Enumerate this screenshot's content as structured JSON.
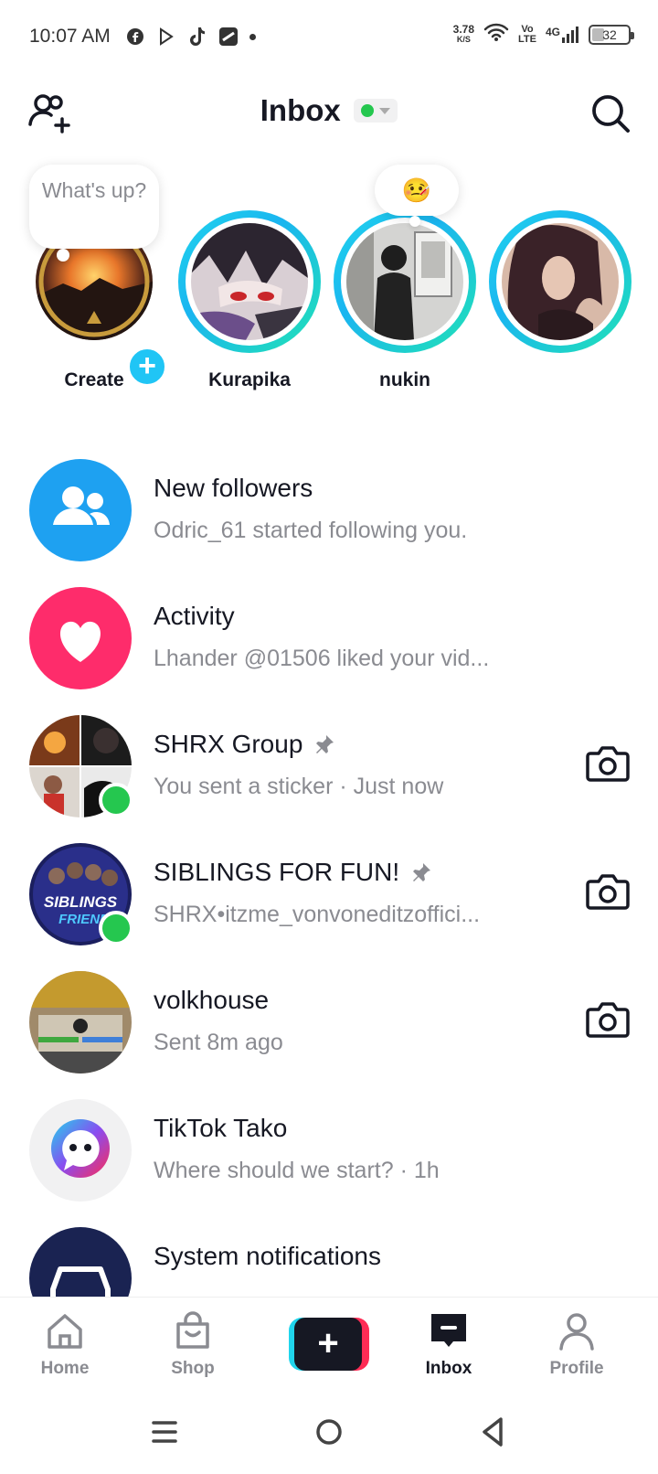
{
  "status_bar": {
    "time": "10:07 AM",
    "speed_value": "3.78",
    "speed_unit": "K/S",
    "volte_top": "Vo",
    "volte_bottom": "LTE",
    "network": "4G",
    "battery": "32"
  },
  "header": {
    "title": "Inbox",
    "status_color": "#25c74f"
  },
  "stories": {
    "bubble_text": "What's up?",
    "bubble_emoji": "🤒",
    "items": [
      {
        "name": "Create"
      },
      {
        "name": "Kurapika"
      },
      {
        "name": "nukin"
      },
      {
        "name": ""
      }
    ]
  },
  "list": [
    {
      "title": "New followers",
      "subtitle": "Odric_61 started following you."
    },
    {
      "title": "Activity",
      "subtitle": "Lhander @01506 liked your vid..."
    },
    {
      "title": "SHRX Group",
      "subtitle": "You sent a sticker · Just now"
    },
    {
      "title": "SIBLINGS FOR FUN!",
      "subtitle": "SHRX•itzme_vonvoneditzoffici..."
    },
    {
      "title": "volkhouse",
      "subtitle": "Sent 8m ago"
    },
    {
      "title": "TikTok Tako",
      "subtitle": "Where should we start?  · 1h"
    },
    {
      "title": "System notifications",
      "subtitle": ""
    }
  ],
  "avatar_art": {
    "group_tile_label": "SIBLINGS",
    "group_tile_sub": "FRIEND"
  },
  "bottom_nav": {
    "home": "Home",
    "shop": "Shop",
    "create": "+",
    "inbox": "Inbox",
    "profile": "Profile"
  },
  "colors": {
    "accent_cyan": "#20d5ec",
    "accent_pink": "#fe2c55",
    "followers_blue": "#1ea1f1",
    "activity_pink": "#fe2c6b",
    "online_green": "#25c74f"
  }
}
